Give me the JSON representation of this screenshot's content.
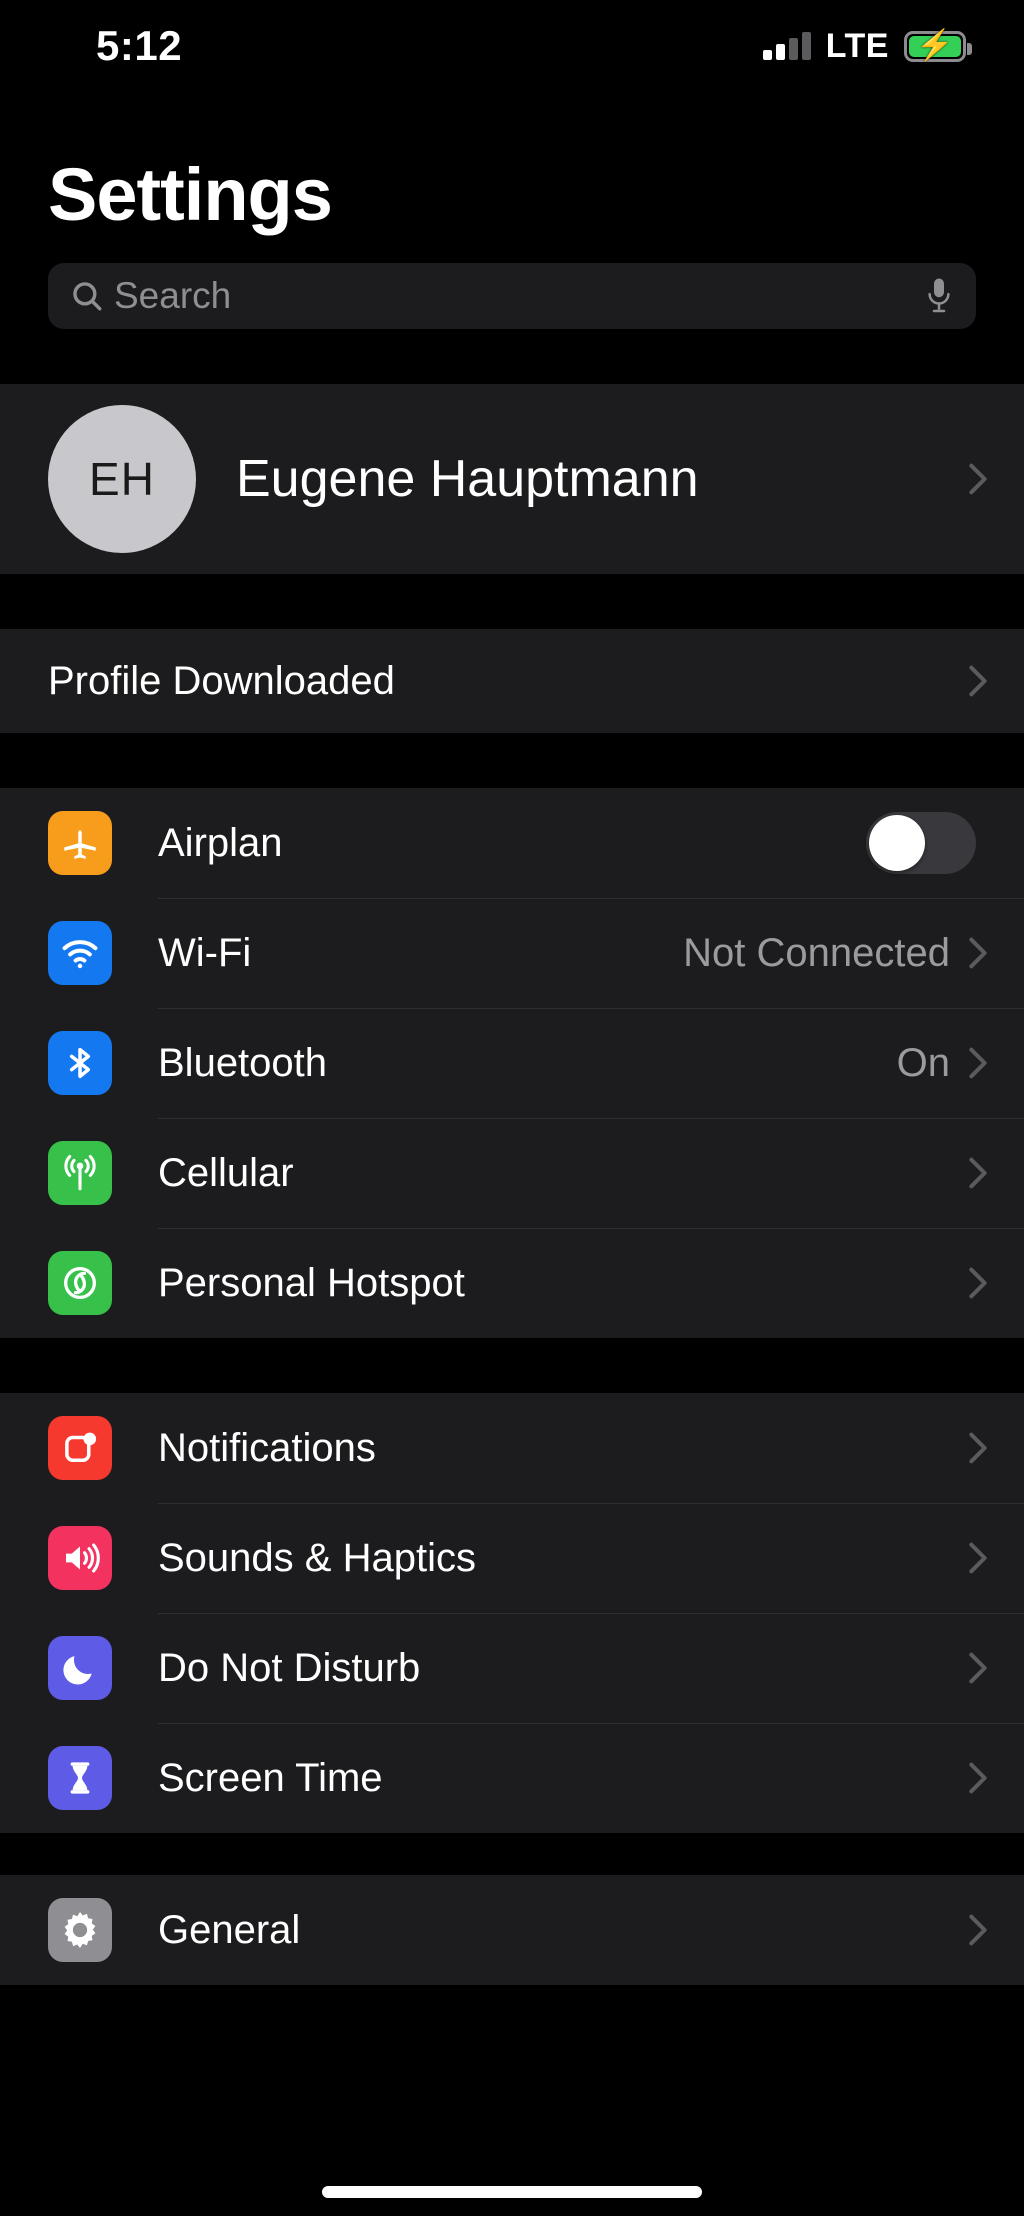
{
  "status_bar": {
    "time": "5:12",
    "carrier_tech": "LTE",
    "signal_bars_total": 4,
    "signal_bars_filled": 2,
    "battery_charging": true,
    "battery_color": "#33cf57",
    "signal_icon": "cellular-bars-icon",
    "battery_icon": "battery-charging-icon"
  },
  "header": {
    "title": "Settings"
  },
  "search": {
    "placeholder": "Search",
    "value": "",
    "search_icon": "search-icon",
    "mic_icon": "microphone-icon"
  },
  "profile": {
    "initials": "EH",
    "name": "Eugene Hauptmann",
    "avatar_color": "#c8c8cc",
    "chevron_icon": "chevron-right-icon"
  },
  "profile_notice": {
    "label": "Profile Downloaded",
    "chevron_icon": "chevron-right-icon"
  },
  "connectivity": [
    {
      "label": "Airplan",
      "icon": "airplane-icon",
      "icon_color": "#f89c1c",
      "control": "toggle",
      "toggle_on": false,
      "value": ""
    },
    {
      "label": "Wi-Fi",
      "icon": "wifi-icon",
      "icon_color": "#1478f0",
      "control": "chevron",
      "value": "Not Connected"
    },
    {
      "label": "Bluetooth",
      "icon": "bluetooth-icon",
      "icon_color": "#1478f0",
      "control": "chevron",
      "value": "On"
    },
    {
      "label": "Cellular",
      "icon": "cellular-antenna-icon",
      "icon_color": "#37c04a",
      "control": "chevron",
      "value": ""
    },
    {
      "label": "Personal Hotspot",
      "icon": "hotspot-link-icon",
      "icon_color": "#37c04a",
      "control": "chevron",
      "value": ""
    }
  ],
  "alerts": [
    {
      "label": "Notifications",
      "icon": "notifications-icon",
      "icon_color": "#f6392e",
      "control": "chevron",
      "value": ""
    },
    {
      "label": "Sounds & Haptics",
      "icon": "speaker-icon",
      "icon_color": "#f43260",
      "control": "chevron",
      "value": ""
    },
    {
      "label": "Do Not Disturb",
      "icon": "moon-icon",
      "icon_color": "#5e5ce6",
      "control": "chevron",
      "value": ""
    },
    {
      "label": "Screen Time",
      "icon": "hourglass-icon",
      "icon_color": "#5e5ce6",
      "control": "chevron",
      "value": ""
    }
  ],
  "system": [
    {
      "label": "General",
      "icon": "gear-icon",
      "icon_color": "#8e8e93",
      "control": "chevron",
      "value": ""
    }
  ]
}
